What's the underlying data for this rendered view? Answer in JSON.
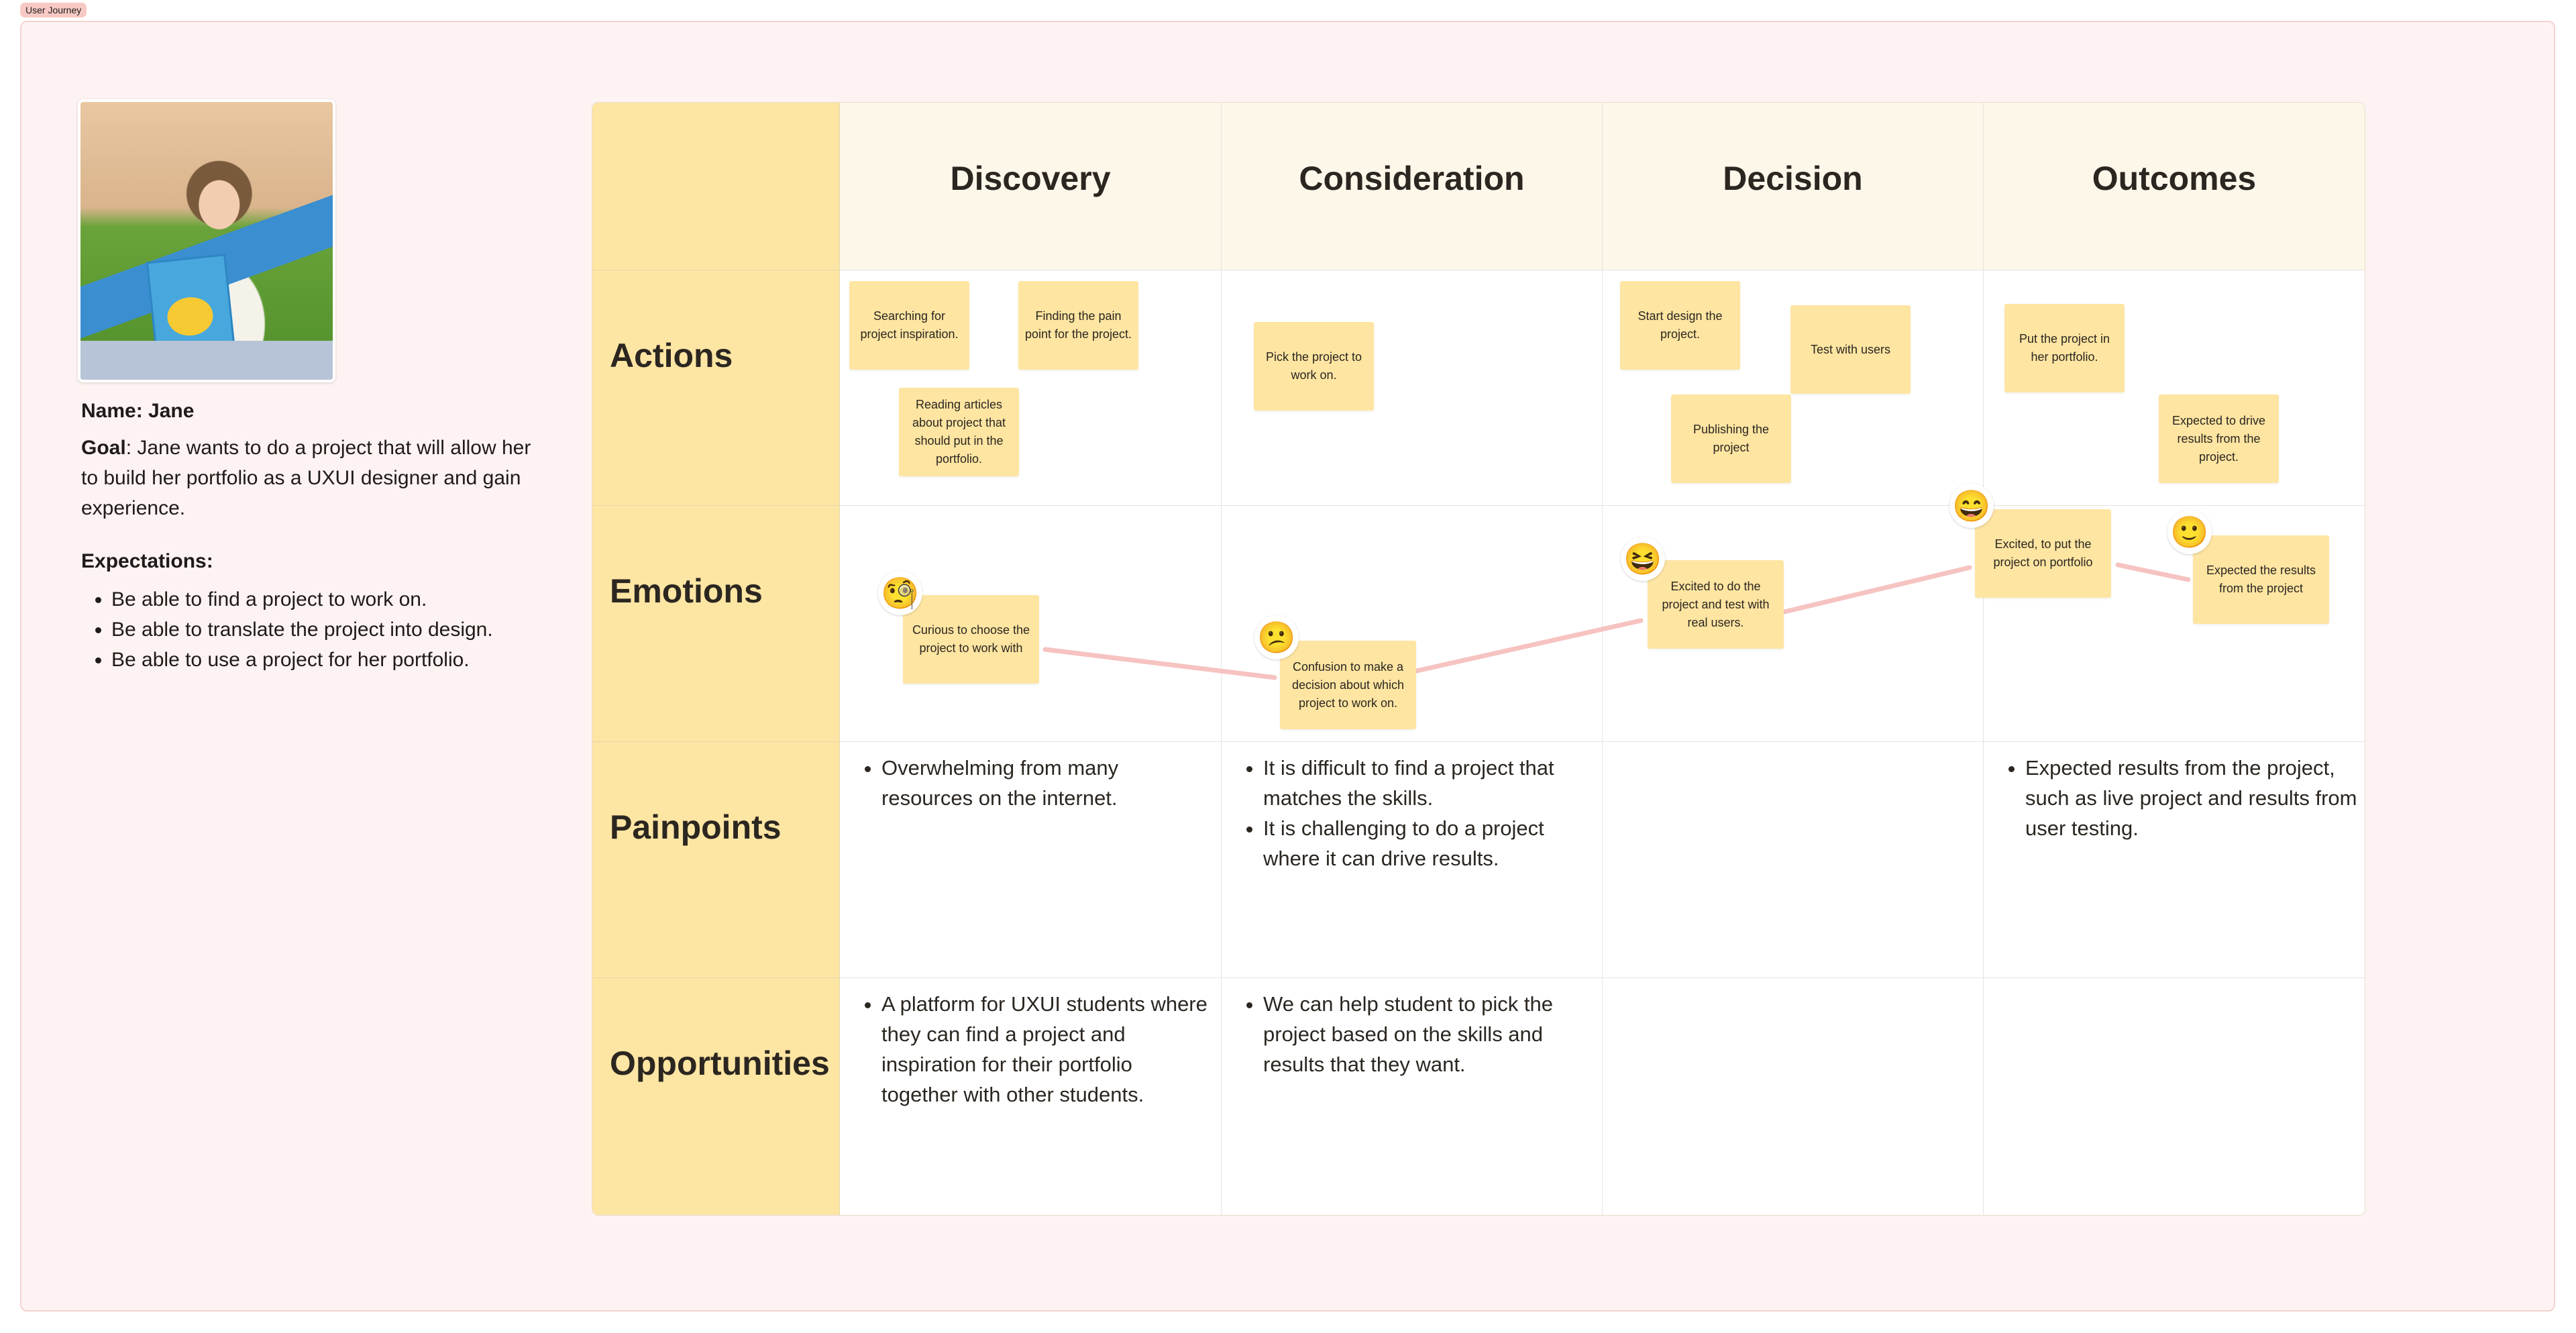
{
  "frame": {
    "label": "User Journey"
  },
  "persona": {
    "photo_alt": "Persona photo of Jane",
    "name_label": "Name:",
    "name_value": "Jane",
    "goal_label": "Goal",
    "goal_text": ": Jane wants to do a project that will allow her to build her portfolio as a UXUI designer and gain experience.",
    "expectations_label": "Expectations:",
    "expectations": [
      "Be able to find a project to work on.",
      "Be able to translate the project into design.",
      "Be able to use a project for her portfolio."
    ]
  },
  "journey_map": {
    "stages": [
      "Discovery",
      "Consideration",
      "Decision",
      "Outcomes"
    ],
    "rows": [
      "Actions",
      "Emotions",
      "Painpoints",
      "Opportunities"
    ],
    "actions": {
      "discovery": [
        "Searching for project inspiration.",
        "Finding the pain point for the project.",
        "Reading articles about project that should put in the portfolio."
      ],
      "consideration": [
        "Pick the project to work on."
      ],
      "decision": [
        "Start design the project.",
        "Test with users",
        "Publishing the project"
      ],
      "outcomes": [
        "Put the project in her portfolio.",
        "Expected to drive results from the project."
      ]
    },
    "emotions": [
      {
        "stage": "Discovery",
        "text": "Curious to choose the project to work with",
        "emoji": "face-with-monocle",
        "glyph": "🧐"
      },
      {
        "stage": "Consideration",
        "text": "Confusion to make a decision about which project to work on.",
        "emoji": "confused-face",
        "glyph": "😕"
      },
      {
        "stage": "Decision",
        "text": "Excited to do the project and test with real users.",
        "emoji": "grinning-squinting-face",
        "glyph": "😆"
      },
      {
        "stage": "Outcomes",
        "text": "Excited, to put the project on portfolio",
        "emoji": "grinning-face-with-smiling-eyes",
        "glyph": "😄"
      },
      {
        "stage": "Outcomes",
        "text": "Expected the results from the project",
        "emoji": "slightly-smiling-face",
        "glyph": "🙂"
      }
    ],
    "emotion_line_color": "#f6c3c1",
    "painpoints": {
      "discovery": [
        "Overwhelming from many resources on the internet."
      ],
      "consideration": [
        "It is difficult to find a project that matches the skills.",
        "It is challenging to do a project where it can drive results."
      ],
      "decision": [],
      "outcomes": [
        "Expected results from the project, such as live project and results from user testing."
      ]
    },
    "opportunities": {
      "discovery": [
        "A platform for UXUI students where they can find a project and inspiration for their portfolio together with other students."
      ],
      "consideration": [
        "We can help student to pick the project based on the skills and results that they want."
      ],
      "decision": [],
      "outcomes": []
    }
  },
  "colors": {
    "frame_bg": "#fdf3f2",
    "frame_tag": "#f8c9c4",
    "label_column": "#fde5a3",
    "header_bg": "#fdf7ea",
    "sticky": "#fee5a2",
    "emotion_line": "#f6c3c1"
  }
}
